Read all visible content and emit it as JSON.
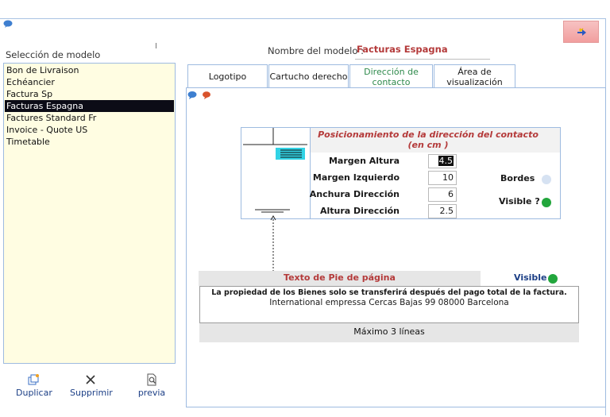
{
  "left": {
    "selection_label": "Selección de modelo",
    "models": [
      "Bon de Livraison",
      "Echéancier",
      "Factura Sp",
      "Facturas  Espagna",
      "Factures Standard Fr",
      "Invoice - Quote US",
      "Timetable"
    ],
    "selected_index": 3,
    "buttons": {
      "duplicate": "Duplicar",
      "delete": "Supprimir",
      "preview": "previa"
    }
  },
  "header": {
    "name_label": "Nombre del modelo  :",
    "name_value": "Facturas  Espagna"
  },
  "tabs": [
    {
      "label": "Logotipo",
      "active": false
    },
    {
      "label": "Cartucho derecho",
      "active": false
    },
    {
      "label": "Dirección de contacto",
      "active": true
    },
    {
      "label": "Área de visualización",
      "active": false
    }
  ],
  "position": {
    "title": "Posicionamiento de la dirección del contacto (en cm )",
    "fields": [
      {
        "label": "Margen Altura",
        "value": "4.5"
      },
      {
        "label": "Margen Izquierdo",
        "value": "10"
      },
      {
        "label": "Anchura Dirección",
        "value": "6"
      },
      {
        "label": "Altura Dirección",
        "value": "2.5"
      }
    ],
    "borders_label": "Bordes",
    "visible_label": "Visible ?"
  },
  "footer": {
    "title": "Texto de Pie de página",
    "visible_label": "Visible",
    "line1": "La propiedad de los Bienes solo se transferirá después del pago total de la factura.",
    "line2": "International empressa Cercas Bajas 99 08000  Barcelona",
    "max_lines": "Máximo 3 líneas"
  },
  "colors": {
    "accent_red": "#b43a3a",
    "active_tab_green": "#2f8a4c",
    "visible_green": "#22a63c",
    "border_off": "#d6e2f2",
    "list_bg": "#fffde2"
  },
  "icons": [
    "chat-icon",
    "exit-icon",
    "duplicate-icon",
    "delete-icon",
    "preview-icon",
    "comment-icons"
  ]
}
